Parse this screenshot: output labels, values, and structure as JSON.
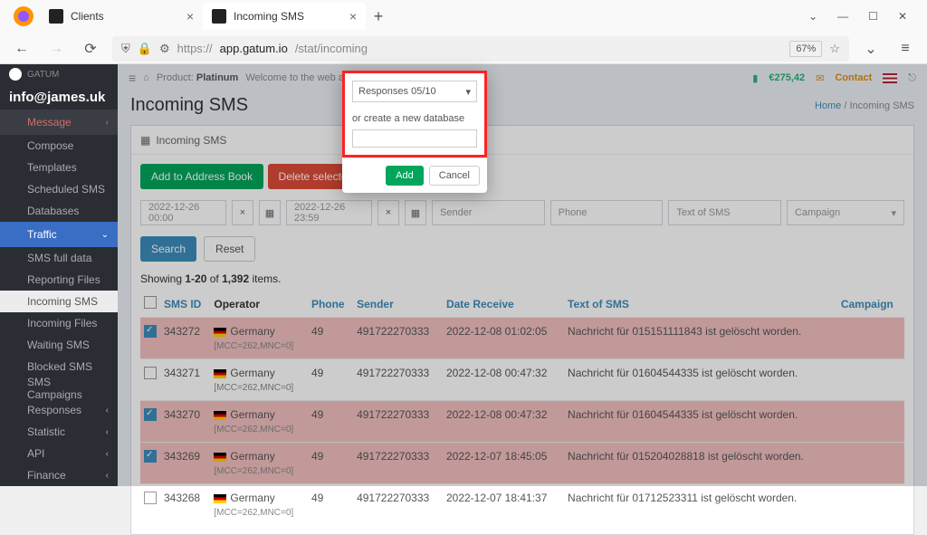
{
  "browser": {
    "tabs": [
      {
        "label": "Clients",
        "active": false
      },
      {
        "label": "Incoming SMS",
        "active": true
      }
    ],
    "url_prefix": "https://",
    "url_host": "app.gatum.io",
    "url_path": "/stat/incoming",
    "zoom": "67%"
  },
  "sidebar": {
    "brand": "GATUM",
    "email": "info@james.uk",
    "items": [
      {
        "label": "Message",
        "type": "msg",
        "chev": true
      },
      {
        "label": "Compose"
      },
      {
        "label": "Templates"
      },
      {
        "label": "Scheduled SMS"
      },
      {
        "label": "Databases"
      },
      {
        "label": "Traffic",
        "type": "highlight",
        "chev": true
      },
      {
        "label": "SMS full data"
      },
      {
        "label": "Reporting Files"
      },
      {
        "label": "Incoming SMS",
        "type": "active-light"
      },
      {
        "label": "Incoming Files"
      },
      {
        "label": "Waiting SMS"
      },
      {
        "label": "Blocked SMS"
      },
      {
        "label": "SMS Campaigns"
      },
      {
        "label": "Responses",
        "chev": true
      },
      {
        "label": "Statistic",
        "chev": true
      },
      {
        "label": "API",
        "chev": true
      },
      {
        "label": "Finance",
        "chev": true
      }
    ]
  },
  "topbar": {
    "product_lbl": "Product:",
    "product": "Platinum",
    "welcome": "Welcome to the web app for BUL...",
    "balance": "€275,42",
    "contact": "Contact"
  },
  "page": {
    "title": "Incoming SMS",
    "crumb_home": "Home",
    "crumb_sep": " / ",
    "crumb_here": "Incoming SMS"
  },
  "panel": {
    "header": "Incoming SMS",
    "add_btn": "Add to Address Book",
    "del_btn": "Delete selected numbers",
    "filters": {
      "from": "2022-12-26 00:00",
      "to": "2022-12-26 23:59",
      "sender": "Sender",
      "phone": "Phone",
      "text": "Text of SMS",
      "campaign": "Campaign"
    },
    "search": "Search",
    "reset": "Reset",
    "summary_pre": "Showing ",
    "summary_range": "1-20",
    "summary_of": " of ",
    "summary_total": "1,392",
    "summary_post": " items."
  },
  "table": {
    "cols": {
      "smsid": "SMS ID",
      "operator": "Operator",
      "phone": "Phone",
      "sender": "Sender",
      "date": "Date Receive",
      "text": "Text of SMS",
      "campaign": "Campaign"
    },
    "country": "Germany",
    "mcc": "[MCC=262,MNC=0]",
    "rows": [
      {
        "sel": true,
        "id": "343272",
        "phone": "49",
        "sender": "491722270333",
        "date": "2022-12-08 01:02:05",
        "text": "Nachricht für 015151111843 ist gelöscht worden."
      },
      {
        "sel": false,
        "id": "343271",
        "phone": "49",
        "sender": "491722270333",
        "date": "2022-12-08 00:47:32",
        "text": "Nachricht für 01604544335 ist gelöscht worden."
      },
      {
        "sel": true,
        "id": "343270",
        "phone": "49",
        "sender": "491722270333",
        "date": "2022-12-08 00:47:32",
        "text": "Nachricht für 01604544335 ist gelöscht worden."
      },
      {
        "sel": true,
        "id": "343269",
        "phone": "49",
        "sender": "491722270333",
        "date": "2022-12-07 18:45:05",
        "text": "Nachricht für 015204028818 ist gelöscht worden."
      },
      {
        "sel": false,
        "id": "343268",
        "phone": "49",
        "sender": "491722270333",
        "date": "2022-12-07 18:41:37",
        "text": "Nachricht für 01712523311 ist gelöscht worden."
      }
    ]
  },
  "modal": {
    "select_value": "Responses 05/10",
    "or_label": "or create a new database",
    "add": "Add",
    "cancel": "Cancel"
  }
}
